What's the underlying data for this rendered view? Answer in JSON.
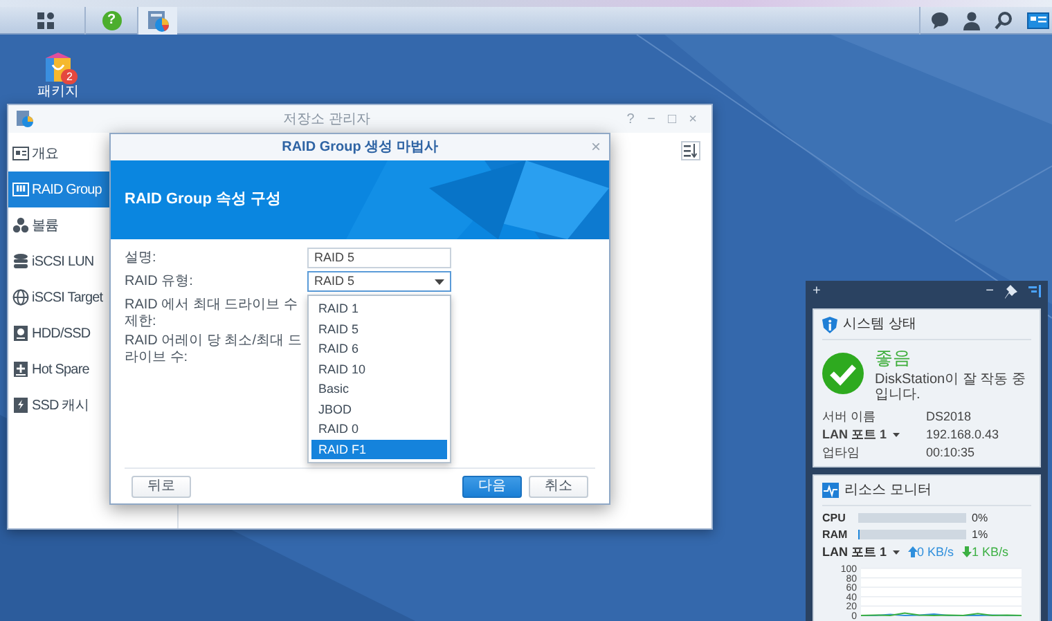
{
  "taskbar": {
    "help_label": "?"
  },
  "desktop_icons": [
    {
      "label": "패키지",
      "badge": "2"
    }
  ],
  "window": {
    "title": "저장소 관리자",
    "controls": [
      "?",
      "−",
      "□",
      "×"
    ],
    "sidebar": [
      {
        "label": "개요",
        "kind": "overview",
        "selected": false
      },
      {
        "label": "RAID Group",
        "kind": "raid",
        "selected": true
      },
      {
        "label": "볼륨",
        "kind": "volume",
        "selected": false
      },
      {
        "label": "iSCSI LUN",
        "kind": "lun",
        "selected": false
      },
      {
        "label": "iSCSI Target",
        "kind": "target",
        "selected": false
      },
      {
        "label": "HDD/SSD",
        "kind": "disk",
        "selected": false
      },
      {
        "label": "Hot Spare",
        "kind": "spare",
        "selected": false
      },
      {
        "label": "SSD 캐시",
        "kind": "cache",
        "selected": false
      }
    ]
  },
  "dialog": {
    "title": "RAID Group 생성 마법사",
    "close": "×",
    "banner": "RAID Group 속성 구성",
    "fields": [
      {
        "label": "설명:",
        "kind": "text",
        "value": "RAID 5"
      },
      {
        "label": "RAID 유형:",
        "kind": "select",
        "value": "RAID 5",
        "expanded": true
      },
      {
        "label": "RAID 에서 최대 드라이브 수 제한:",
        "kind": "label"
      },
      {
        "label": "RAID 어레이 당 최소/최대 드라이브 수:",
        "kind": "label"
      }
    ],
    "options": [
      {
        "label": "RAID 1",
        "selected": false
      },
      {
        "label": "RAID 5",
        "selected": false
      },
      {
        "label": "RAID 6",
        "selected": false
      },
      {
        "label": "RAID 10",
        "selected": false
      },
      {
        "label": "Basic",
        "selected": false
      },
      {
        "label": "JBOD",
        "selected": false
      },
      {
        "label": "RAID 0",
        "selected": false
      },
      {
        "label": "RAID F1",
        "selected": true
      }
    ],
    "buttons": [
      {
        "label": "뒤로",
        "kind": "default"
      },
      {
        "label": "다음",
        "kind": "primary"
      },
      {
        "label": "취소",
        "kind": "default"
      }
    ]
  },
  "widget": {
    "header": {
      "add": "+",
      "minimize": "−"
    },
    "system": {
      "title": "시스템 상태",
      "status": "좋음",
      "message": "DiskStation이 잘 작동 중입니다.",
      "rows": [
        {
          "label": "서버 이름",
          "value": "DS2018",
          "dropdown": false
        },
        {
          "label": "LAN 포트 1",
          "value": "192.168.0.43",
          "dropdown": true
        },
        {
          "label": "업타임",
          "value": "00:10:35",
          "dropdown": false
        }
      ]
    },
    "resource": {
      "title": "리소스 모니터",
      "meters": [
        {
          "label": "CPU",
          "level": 0,
          "reading": "0%"
        },
        {
          "label": "RAM",
          "level": 0.01,
          "reading": "1%"
        }
      ],
      "lan": {
        "label": "LAN 포트 1",
        "upload": "0 KB/s",
        "download": "1 KB/s"
      },
      "chart_data": {
        "type": "line",
        "ylim": [
          0,
          100
        ],
        "yticks": [
          0,
          20,
          40,
          60,
          80,
          100
        ],
        "grid": true,
        "series": [
          {
            "color": "#2f8fdc",
            "values": [
              0,
              0,
              2,
              0,
              1,
              3,
              0,
              0,
              0,
              1,
              0,
              0
            ]
          },
          {
            "color": "#3cb043",
            "values": [
              0,
              1,
              0,
              5,
              1,
              0,
              1,
              0,
              4,
              0,
              1,
              0
            ]
          }
        ]
      }
    }
  }
}
